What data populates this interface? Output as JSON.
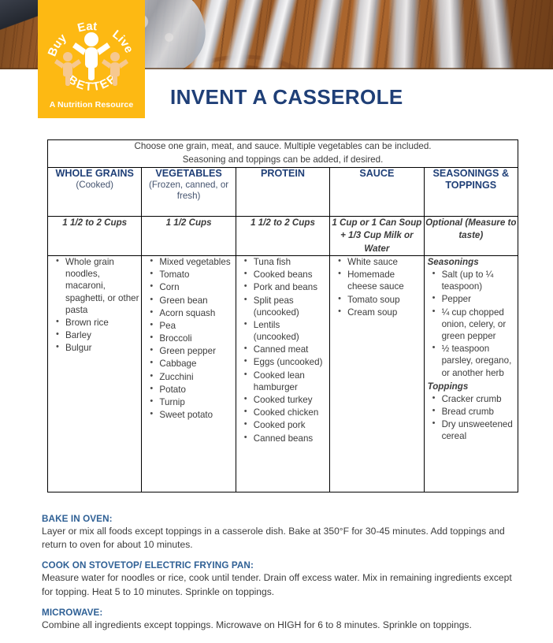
{
  "logo": {
    "word_top_left": "Buy",
    "word_top_mid": "Eat",
    "word_top_right": "Live",
    "word_bottom": "BETTER",
    "caption": "A Nutrition Resource",
    "background_color": "#fdb913"
  },
  "header": {
    "title": "INVENT A CASSEROLE",
    "title_color": "#1f3f77"
  },
  "table": {
    "intro_line1": "Choose one grain, meat, and sauce. Multiple vegetables can be included.",
    "intro_line2": "Seasoning and toppings can be added, if desired.",
    "columns": [
      {
        "id": "whole-grains",
        "title": "WHOLE GRAINS",
        "subtitle": "(Cooked)",
        "amount": "1 1/2 to 2 Cups",
        "items": [
          "Whole grain noodles, macaroni, spaghetti, or other pasta",
          "Brown rice",
          "Barley",
          "Bulgur"
        ]
      },
      {
        "id": "vegetables",
        "title": "VEGETABLES",
        "subtitle": "(Frozen, canned, or fresh)",
        "amount": "1 1/2 Cups",
        "items": [
          "Mixed vegetables",
          "Tomato",
          "Corn",
          "Green bean",
          "Acorn squash",
          "Pea",
          "Broccoli",
          "Green pepper",
          "Cabbage",
          "Zucchini",
          "Potato",
          "Turnip",
          "Sweet potato"
        ]
      },
      {
        "id": "protein",
        "title": "PROTEIN",
        "subtitle": "",
        "amount": "1 1/2 to 2 Cups",
        "items": [
          "Tuna fish",
          "Cooked beans",
          "Pork and beans",
          "Split peas (uncooked)",
          "Lentils (uncooked)",
          "Canned meat",
          "Eggs (uncooked)",
          "Cooked lean hamburger",
          "Cooked turkey",
          "Cooked chicken",
          "Cooked pork",
          "Canned beans"
        ]
      },
      {
        "id": "sauce",
        "title": "SAUCE",
        "subtitle": "",
        "amount": "1 Cup or 1 Can Soup + 1/3 Cup Milk or Water",
        "items": [
          "White sauce",
          "Homemade cheese sauce",
          "Tomato soup",
          "Cream soup"
        ]
      },
      {
        "id": "seasonings-toppings",
        "title": "SEASONINGS & TOPPINGS",
        "subtitle": "",
        "amount": "Optional (Measure to taste)",
        "group1_label": "Seasonings",
        "group1_items": [
          "Salt (up to ¼ teaspoon)",
          "Pepper",
          "¼ cup chopped onion, celery, or green pepper",
          "½ teaspoon parsley, oregano, or another herb"
        ],
        "group2_label": "Toppings",
        "group2_items": [
          "Cracker crumb",
          "Bread crumb",
          "Dry unsweetened cereal"
        ]
      }
    ]
  },
  "instructions": [
    {
      "heading": "BAKE IN OVEN:",
      "body": "Layer or mix all foods except toppings in a casserole dish. Bake at 350°F for 30-45 minutes. Add toppings and return to oven for about 10 minutes."
    },
    {
      "heading": "COOK ON STOVETOP/ ELECTRIC FRYING PAN:",
      "body": "Measure water for noodles or rice, cook until tender. Drain off excess water. Mix in remaining ingredients except for topping. Heat 5 to 10 minutes. Sprinkle on toppings."
    },
    {
      "heading": "MICROWAVE:",
      "body": "Combine all ingredients except toppings. Microwave on HIGH for 6 to 8 minutes. Sprinkle on toppings."
    }
  ]
}
